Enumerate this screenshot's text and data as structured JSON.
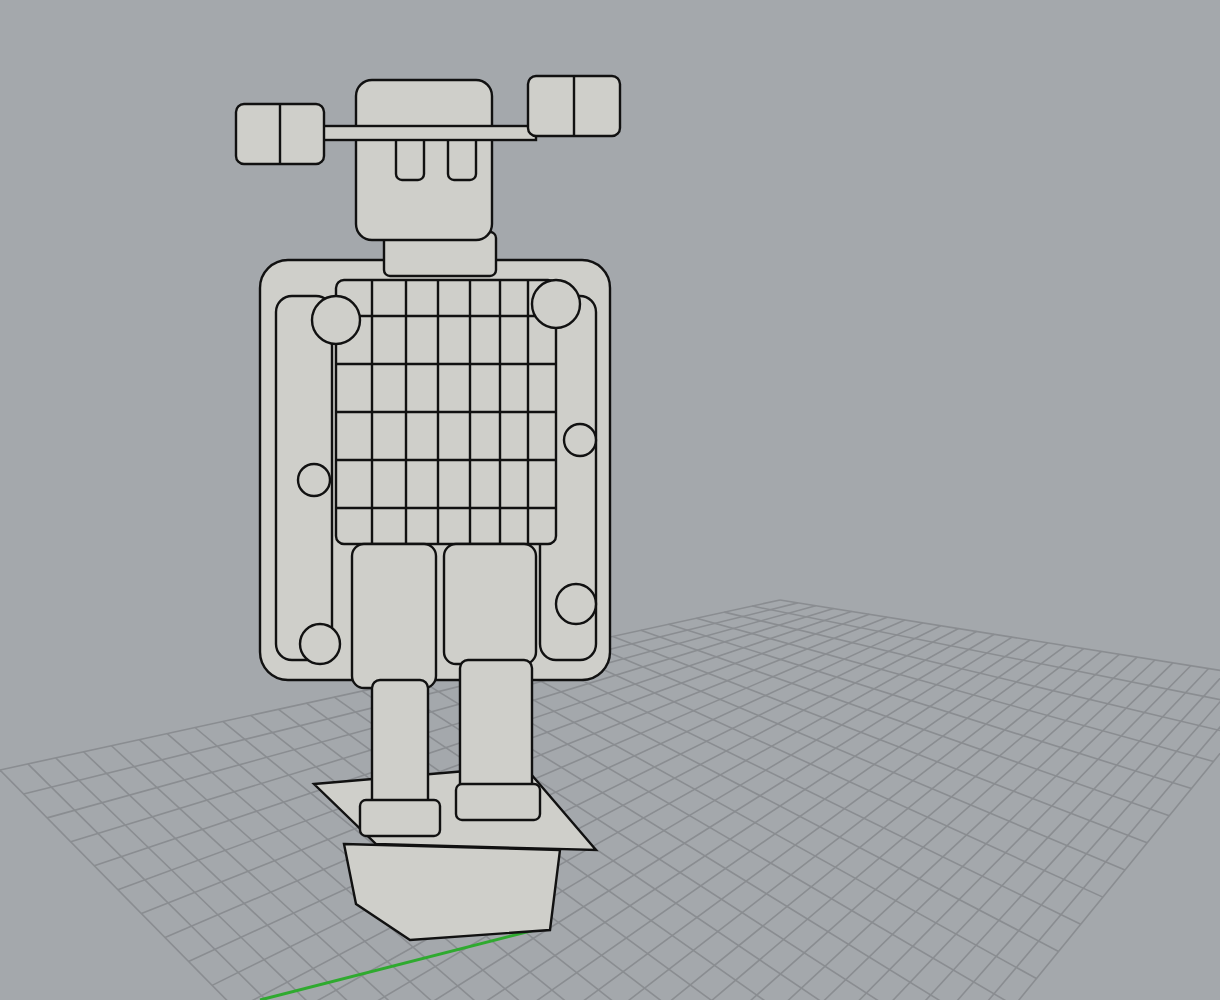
{
  "viewport": {
    "shaded": true,
    "grid_visible": true
  }
}
